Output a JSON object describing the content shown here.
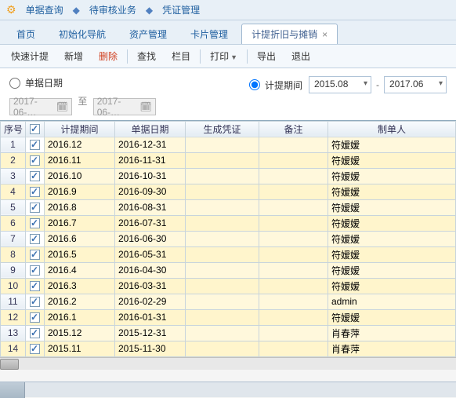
{
  "top_links": {
    "l1": "单据查询",
    "l2": "待审核业务",
    "l3": "凭证管理"
  },
  "tabs": [
    {
      "label": "首页"
    },
    {
      "label": "初始化导航"
    },
    {
      "label": "资产管理"
    },
    {
      "label": "卡片管理"
    },
    {
      "label": "计提折旧与摊销",
      "active": true
    }
  ],
  "toolbar": {
    "fast": "快速计提",
    "add": "新增",
    "del": "删除",
    "find": "查找",
    "cols": "栏目",
    "print": "打印",
    "export": "导出",
    "exit": "退出"
  },
  "filter": {
    "r1_label": "单据日期",
    "r2_label": "计提期间",
    "d1": "2017-06-…",
    "to": "至",
    "d2": "2017-06-…",
    "p1": "2015.08",
    "dash": "-",
    "p2": "2017.06"
  },
  "columns": {
    "seq": "序号",
    "period": "计提期间",
    "date": "单据日期",
    "voucher": "生成凭证",
    "remark": "备注",
    "maker": "制单人"
  },
  "chart_data": {
    "type": "table",
    "columns": [
      "序号",
      "计提期间",
      "单据日期",
      "生成凭证",
      "备注",
      "制单人"
    ],
    "rows": [
      {
        "seq": 1,
        "checked": true,
        "period": "2016.12",
        "date": "2016-12-31",
        "voucher": "",
        "remark": "",
        "maker": "符嫒嫒"
      },
      {
        "seq": 2,
        "checked": true,
        "period": "2016.11",
        "date": "2016-11-31",
        "voucher": "",
        "remark": "",
        "maker": "符嫒嫒"
      },
      {
        "seq": 3,
        "checked": true,
        "period": "2016.10",
        "date": "2016-10-31",
        "voucher": "",
        "remark": "",
        "maker": "符嫒嫒"
      },
      {
        "seq": 4,
        "checked": true,
        "period": "2016.9",
        "date": "2016-09-30",
        "voucher": "",
        "remark": "",
        "maker": "符嫒嫒"
      },
      {
        "seq": 5,
        "checked": true,
        "period": "2016.8",
        "date": "2016-08-31",
        "voucher": "",
        "remark": "",
        "maker": "符嫒嫒"
      },
      {
        "seq": 6,
        "checked": true,
        "period": "2016.7",
        "date": "2016-07-31",
        "voucher": "",
        "remark": "",
        "maker": "符嫒嫒"
      },
      {
        "seq": 7,
        "checked": true,
        "period": "2016.6",
        "date": "2016-06-30",
        "voucher": "",
        "remark": "",
        "maker": "符嫒嫒"
      },
      {
        "seq": 8,
        "checked": true,
        "period": "2016.5",
        "date": "2016-05-31",
        "voucher": "",
        "remark": "",
        "maker": "符嫒嫒"
      },
      {
        "seq": 9,
        "checked": true,
        "period": "2016.4",
        "date": "2016-04-30",
        "voucher": "",
        "remark": "",
        "maker": "符嫒嫒"
      },
      {
        "seq": 10,
        "checked": true,
        "period": "2016.3",
        "date": "2016-03-31",
        "voucher": "",
        "remark": "",
        "maker": "符嫒嫒"
      },
      {
        "seq": 11,
        "checked": true,
        "period": "2016.2",
        "date": "2016-02-29",
        "voucher": "",
        "remark": "",
        "maker": "admin"
      },
      {
        "seq": 12,
        "checked": true,
        "period": "2016.1",
        "date": "2016-01-31",
        "voucher": "",
        "remark": "",
        "maker": "符嫒嫒"
      },
      {
        "seq": 13,
        "checked": true,
        "period": "2015.12",
        "date": "2015-12-31",
        "voucher": "",
        "remark": "",
        "maker": "肖春萍"
      },
      {
        "seq": 14,
        "checked": true,
        "period": "2015.11",
        "date": "2015-11-30",
        "voucher": "",
        "remark": "",
        "maker": "肖春萍"
      }
    ]
  }
}
